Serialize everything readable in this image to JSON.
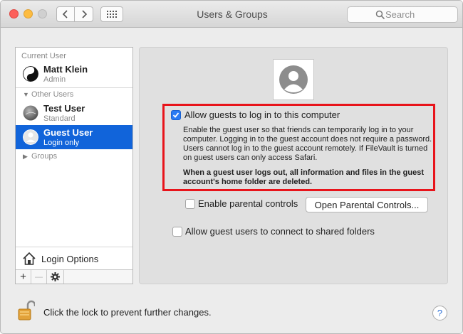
{
  "window": {
    "title": "Users & Groups"
  },
  "search": {
    "placeholder": "Search"
  },
  "sidebar": {
    "current_user_header": "Current User",
    "current_user": {
      "name": "Matt Klein",
      "role": "Admin"
    },
    "other_users_header": "Other Users",
    "users": [
      {
        "name": "Test User",
        "role": "Standard"
      },
      {
        "name": "Guest User",
        "role": "Login only",
        "selected": true
      }
    ],
    "groups_label": "Groups",
    "login_options": "Login Options",
    "buttons": {
      "add": "+",
      "remove": "—"
    }
  },
  "guest": {
    "allow_login_label": "Allow guests to log in to this computer",
    "allow_login_checked": true,
    "description": "Enable the guest user so that friends can temporarily log in to your computer. Logging in to the guest account does not require a password. Users cannot log in to the guest account remotely. If FileVault is turned on guest users can only access Safari.",
    "warning": "When a guest user logs out, all information and files in the guest account's home folder are deleted.",
    "parental_controls_label": "Enable parental controls",
    "parental_controls_checked": false,
    "open_parental_button": "Open Parental Controls...",
    "shared_folders_label": "Allow guest users to connect to shared folders",
    "shared_folders_checked": false
  },
  "footer": {
    "lock_text": "Click the lock to prevent further changes.",
    "help": "?"
  },
  "colors": {
    "selection": "#1164da",
    "highlight_box": "#e8141b",
    "checkbox": "#2a7bf3"
  }
}
